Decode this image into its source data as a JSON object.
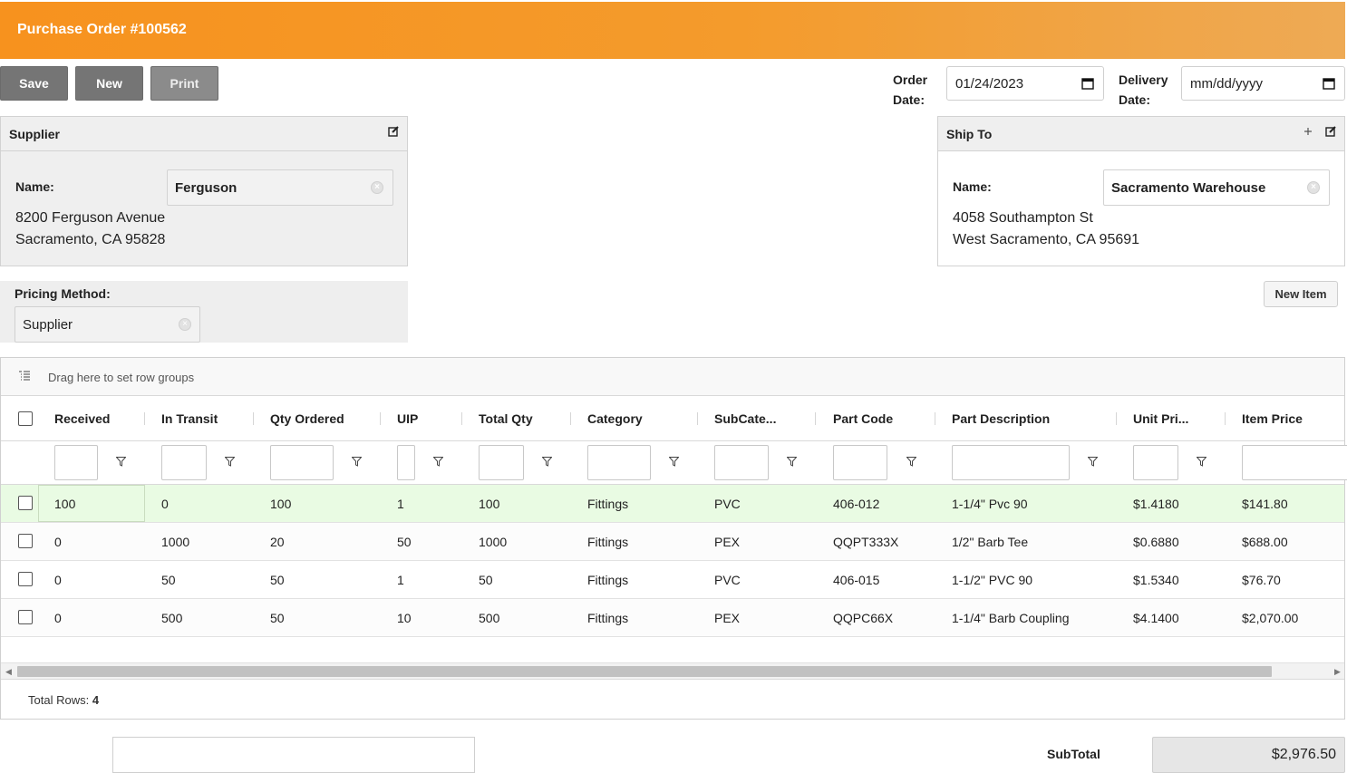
{
  "header": {
    "title": "Purchase Order #100562"
  },
  "toolbar": {
    "save_label": "Save",
    "new_label": "New",
    "print_label": "Print"
  },
  "dates": {
    "order_label_line1": "Order",
    "order_label_line2": "Date:",
    "order_value": "01/24/2023",
    "delivery_label_line1": "Delivery",
    "delivery_label_line2": "Date:",
    "delivery_placeholder": "mm/dd/yyyy"
  },
  "supplier": {
    "title": "Supplier",
    "name_label": "Name:",
    "name_value": "Ferguson",
    "address_line1": "8200 Ferguson Avenue",
    "address_line2": "Sacramento, CA 95828"
  },
  "ship_to": {
    "title": "Ship To",
    "name_label": "Name:",
    "name_value": "Sacramento Warehouse",
    "address_line1": "4058 Southampton St",
    "address_line2": "West Sacramento, CA 95691"
  },
  "pricing": {
    "label": "Pricing Method:",
    "value": "Supplier"
  },
  "new_item_label": "New Item",
  "grid": {
    "group_bar_text": "Drag here to set row groups",
    "columns": [
      "Received",
      "In Transit",
      "Qty Ordered",
      "UIP",
      "Total Qty",
      "Category",
      "SubCate...",
      "Part Code",
      "Part Description",
      "Unit Pri...",
      "Item Price"
    ],
    "rows": [
      [
        "100",
        "0",
        "100",
        "1",
        "100",
        "Fittings",
        "PVC",
        "406-012",
        "1-1/4\" Pvc 90",
        "$1.4180",
        "$141.80"
      ],
      [
        "0",
        "1000",
        "20",
        "50",
        "1000",
        "Fittings",
        "PEX",
        "QQPT333X",
        "1/2\" Barb Tee",
        "$0.6880",
        "$688.00"
      ],
      [
        "0",
        "50",
        "50",
        "1",
        "50",
        "Fittings",
        "PVC",
        "406-015",
        "1-1/2\" PVC 90",
        "$1.5340",
        "$76.70"
      ],
      [
        "0",
        "500",
        "50",
        "10",
        "500",
        "Fittings",
        "PEX",
        "QQPC66X",
        "1-1/4\" Barb Coupling",
        "$4.1400",
        "$2,070.00"
      ]
    ],
    "footer_label": "Total Rows:",
    "footer_count": "4"
  },
  "subtotal": {
    "label": "SubTotal",
    "value": "$2,976.50"
  },
  "colors": {
    "header_orange": "#f7921e",
    "button_gray": "#757575",
    "selected_row": "#e9fbe3"
  },
  "icons": [
    "edit-icon",
    "plus-icon",
    "clear-icon",
    "calendar-icon",
    "filter-icon",
    "row-group-icon"
  ]
}
